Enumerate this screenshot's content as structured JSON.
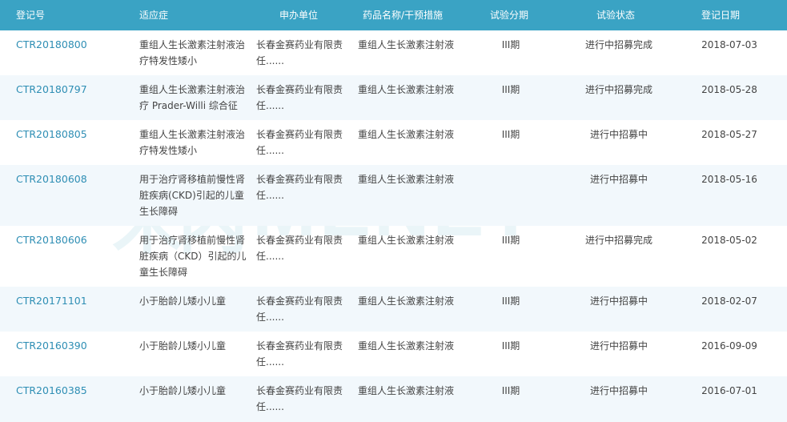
{
  "colors": {
    "header_bg": "#3aa3c4",
    "link": "#2e8eb4",
    "alt_row": "#f2f8fc",
    "watermark_accent": "#f08a24"
  },
  "watermark": {
    "cn": "米内",
    "en": "MENET"
  },
  "table": {
    "headers": {
      "id": "登记号",
      "indication": "适应症",
      "applicant": "申办单位",
      "drug": "药品名称/干预措施",
      "phase": "试验分期",
      "status": "试验状态",
      "date": "登记日期"
    },
    "rows": [
      {
        "id": "CTR20180800",
        "ind1": "重组人生长激素注射液治",
        "ind2": "疗特发性矮小",
        "ind3": "",
        "app1": "长春金赛药业有限责",
        "app2": "任......",
        "drug": "重组人生长激素注射液",
        "phase": "III期",
        "status": "进行中招募完成",
        "date": "2018-07-03"
      },
      {
        "id": "CTR20180797",
        "ind1": "重组人生长激素注射液治",
        "ind2": "疗 Prader-Willi 综合征",
        "ind3": "",
        "app1": "长春金赛药业有限责",
        "app2": "任......",
        "drug": "重组人生长激素注射液",
        "phase": "III期",
        "status": "进行中招募完成",
        "date": "2018-05-28"
      },
      {
        "id": "CTR20180805",
        "ind1": "重组人生长激素注射液治",
        "ind2": "疗特发性矮小",
        "ind3": "",
        "app1": "长春金赛药业有限责",
        "app2": "任......",
        "drug": "重组人生长激素注射液",
        "phase": "III期",
        "status": "进行中招募中",
        "date": "2018-05-27"
      },
      {
        "id": "CTR20180608",
        "ind1": "用于治疗肾移植前慢性肾",
        "ind2": "脏疾病(CKD)引起的儿童",
        "ind3": "生长障碍",
        "app1": "长春金赛药业有限责",
        "app2": "任......",
        "drug": "重组人生长激素注射液",
        "phase": "",
        "status": "进行中招募中",
        "date": "2018-05-16"
      },
      {
        "id": "CTR20180606",
        "ind1": "用于治疗肾移植前慢性肾",
        "ind2": "脏疾病（CKD）引起的儿",
        "ind3": "童生长障碍",
        "app1": "长春金赛药业有限责",
        "app2": "任......",
        "drug": "重组人生长激素注射液",
        "phase": "III期",
        "status": "进行中招募完成",
        "date": "2018-05-02"
      },
      {
        "id": "CTR20171101",
        "ind1": "小于胎龄儿矮小儿童",
        "ind2": "",
        "ind3": "",
        "app1": "长春金赛药业有限责",
        "app2": "任......",
        "drug": "重组人生长激素注射液",
        "phase": "III期",
        "status": "进行中招募中",
        "date": "2018-02-07"
      },
      {
        "id": "CTR20160390",
        "ind1": "小于胎龄儿矮小儿童",
        "ind2": "",
        "ind3": "",
        "app1": "长春金赛药业有限责",
        "app2": "任......",
        "drug": "重组人生长激素注射液",
        "phase": "III期",
        "status": "进行中招募中",
        "date": "2016-09-09"
      },
      {
        "id": "CTR20160385",
        "ind1": "小于胎龄儿矮小儿童",
        "ind2": "",
        "ind3": "",
        "app1": "长春金赛药业有限责",
        "app2": "任......",
        "drug": "重组人生长激素注射液",
        "phase": "III期",
        "status": "进行中招募中",
        "date": "2016-07-01"
      }
    ]
  }
}
